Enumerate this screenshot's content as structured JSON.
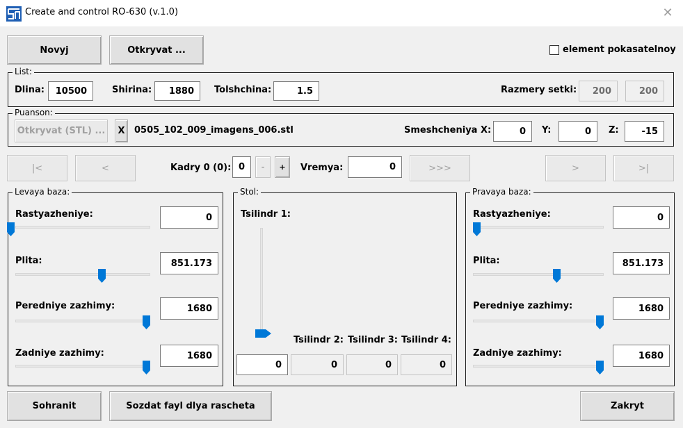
{
  "window": {
    "title": "Create and control RO-630 (v.1.0)",
    "icon": "app-logo-icon",
    "close_icon": "close-icon"
  },
  "toolbar": {
    "new_label": "Novyj",
    "open_label": "Otkryvat ...",
    "checkbox_label": "element pokasatelnoy",
    "checkbox_checked": false
  },
  "list": {
    "legend": "List:",
    "length_label": "Dlina:",
    "length": "10500",
    "width_label": "Shirina:",
    "width": "1880",
    "thickness_label": "Tolshchina:",
    "thickness": "1.5",
    "grid_label": "Razmery setki:",
    "grid_x": "200",
    "grid_y": "200"
  },
  "punch": {
    "legend": "Puanson:",
    "open_stl_label": "Otkryvat (STL) ...",
    "clear_label": "X",
    "filename": "0505_102_009_imagens_006.stl",
    "offset_x_label": "Smeshcheniya X:",
    "offset_x": "0",
    "y_label": "Y:",
    "offset_y": "0",
    "z_label": "Z:",
    "offset_z": "-15"
  },
  "frames": {
    "first_label": "|<",
    "prev_label": "<",
    "frames_label": "Kadry 0 (0):",
    "frame_value": "0",
    "minus_label": "-",
    "plus_label": "+",
    "time_label": "Vremya:",
    "time_value": "0",
    "play_label": ">>>",
    "next_label": ">",
    "last_label": ">|"
  },
  "left_base": {
    "legend": "Levaya baza:",
    "stretch_label": "Rastyazheniye:",
    "stretch": "0",
    "stretch_level": 0.0,
    "plate_label": "Plita:",
    "plate": "851.173",
    "plate_level": 0.65,
    "front_label": "Peredniye zazhimy:",
    "front": "1680",
    "front_level": 1.0,
    "rear_label": "Zadniye zazhimy:",
    "rear": "1680",
    "rear_level": 1.0
  },
  "table": {
    "legend": "Stol:",
    "cyl1_label": "Tsilindr 1:",
    "cyl1": "0",
    "cyl1_level": 0.0,
    "cyl2_label": "Tsilindr 2:",
    "cyl2": "0",
    "cyl3_label": "Tsilindr 3:",
    "cyl3": "0",
    "cyl4_label": "Tsilindr 4:",
    "cyl4": "0"
  },
  "right_base": {
    "legend": "Pravaya baza:",
    "stretch_label": "Rastyazheniye:",
    "stretch": "0",
    "stretch_level": 0.0,
    "plate_label": "Plita:",
    "plate": "851.173",
    "plate_level": 0.65,
    "front_label": "Peredniye zazhimy:",
    "front": "1680",
    "front_level": 1.0,
    "rear_label": "Zadniye zazhimy:",
    "rear": "1680",
    "rear_level": 1.0
  },
  "footer": {
    "save_label": "Sohranit",
    "create_file_label": "Sozdat fayl dlya rascheta",
    "close_label": "Zakryt"
  },
  "colors": {
    "accent": "#0078d7",
    "group_border": "#1e1e1e",
    "background": "#f0f0f0"
  }
}
